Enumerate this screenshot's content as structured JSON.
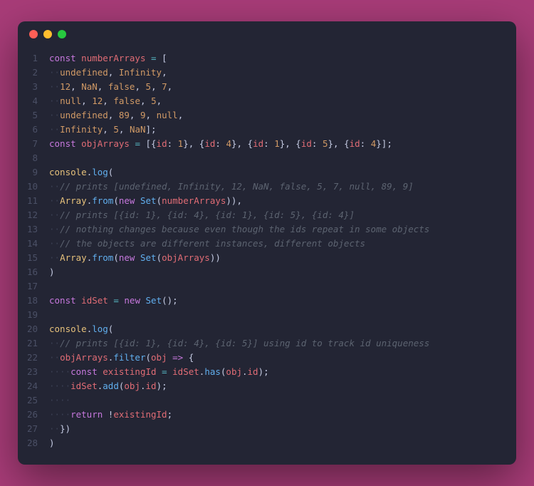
{
  "titlebar": {
    "buttons": [
      "close",
      "minimize",
      "zoom"
    ]
  },
  "code": {
    "lines": [
      [
        {
          "t": "const",
          "c": "kw"
        },
        {
          "t": " "
        },
        {
          "t": "numberArrays",
          "c": "var"
        },
        {
          "t": " "
        },
        {
          "t": "=",
          "c": "op"
        },
        {
          "t": " ["
        }
      ],
      [
        {
          "t": "··",
          "c": "ws"
        },
        {
          "t": "undefined",
          "c": "lit"
        },
        {
          "t": ", "
        },
        {
          "t": "Infinity",
          "c": "lit"
        },
        {
          "t": ","
        }
      ],
      [
        {
          "t": "··",
          "c": "ws"
        },
        {
          "t": "12",
          "c": "lit"
        },
        {
          "t": ", "
        },
        {
          "t": "NaN",
          "c": "lit"
        },
        {
          "t": ", "
        },
        {
          "t": "false",
          "c": "lit"
        },
        {
          "t": ", "
        },
        {
          "t": "5",
          "c": "lit"
        },
        {
          "t": ", "
        },
        {
          "t": "7",
          "c": "lit"
        },
        {
          "t": ","
        }
      ],
      [
        {
          "t": "··",
          "c": "ws"
        },
        {
          "t": "null",
          "c": "lit"
        },
        {
          "t": ", "
        },
        {
          "t": "12",
          "c": "lit"
        },
        {
          "t": ", "
        },
        {
          "t": "false",
          "c": "lit"
        },
        {
          "t": ", "
        },
        {
          "t": "5",
          "c": "lit"
        },
        {
          "t": ","
        }
      ],
      [
        {
          "t": "··",
          "c": "ws"
        },
        {
          "t": "undefined",
          "c": "lit"
        },
        {
          "t": ", "
        },
        {
          "t": "89",
          "c": "lit"
        },
        {
          "t": ", "
        },
        {
          "t": "9",
          "c": "lit"
        },
        {
          "t": ", "
        },
        {
          "t": "null",
          "c": "lit"
        },
        {
          "t": ","
        }
      ],
      [
        {
          "t": "··",
          "c": "ws"
        },
        {
          "t": "Infinity",
          "c": "lit"
        },
        {
          "t": ", "
        },
        {
          "t": "5",
          "c": "lit"
        },
        {
          "t": ", "
        },
        {
          "t": "NaN",
          "c": "lit"
        },
        {
          "t": "];"
        }
      ],
      [
        {
          "t": "const",
          "c": "kw"
        },
        {
          "t": " "
        },
        {
          "t": "objArrays",
          "c": "var"
        },
        {
          "t": " "
        },
        {
          "t": "=",
          "c": "op"
        },
        {
          "t": " [{"
        },
        {
          "t": "id",
          "c": "prop"
        },
        {
          "t": ": "
        },
        {
          "t": "1",
          "c": "lit"
        },
        {
          "t": "}, {"
        },
        {
          "t": "id",
          "c": "prop"
        },
        {
          "t": ": "
        },
        {
          "t": "4",
          "c": "lit"
        },
        {
          "t": "}, {"
        },
        {
          "t": "id",
          "c": "prop"
        },
        {
          "t": ": "
        },
        {
          "t": "1",
          "c": "lit"
        },
        {
          "t": "}, {"
        },
        {
          "t": "id",
          "c": "prop"
        },
        {
          "t": ": "
        },
        {
          "t": "5",
          "c": "lit"
        },
        {
          "t": "}, {"
        },
        {
          "t": "id",
          "c": "prop"
        },
        {
          "t": ": "
        },
        {
          "t": "4",
          "c": "lit"
        },
        {
          "t": "}];"
        }
      ],
      [],
      [
        {
          "t": "console",
          "c": "cls"
        },
        {
          "t": "."
        },
        {
          "t": "log",
          "c": "fn"
        },
        {
          "t": "("
        }
      ],
      [
        {
          "t": "··",
          "c": "ws"
        },
        {
          "t": "// prints [undefined, Infinity, 12, NaN, false, 5, 7, null, 89, 9]",
          "c": "com"
        }
      ],
      [
        {
          "t": "··",
          "c": "ws"
        },
        {
          "t": "Array",
          "c": "cls"
        },
        {
          "t": "."
        },
        {
          "t": "from",
          "c": "fn"
        },
        {
          "t": "("
        },
        {
          "t": "new",
          "c": "kw"
        },
        {
          "t": " "
        },
        {
          "t": "Set",
          "c": "fn"
        },
        {
          "t": "("
        },
        {
          "t": "numberArrays",
          "c": "var"
        },
        {
          "t": ")),"
        }
      ],
      [
        {
          "t": "··",
          "c": "ws"
        },
        {
          "t": "// prints [{id: 1}, {id: 4}, {id: 1}, {id: 5}, {id: 4}]",
          "c": "com"
        }
      ],
      [
        {
          "t": "··",
          "c": "ws"
        },
        {
          "t": "// nothing changes because even though the ids repeat in some objects",
          "c": "com"
        }
      ],
      [
        {
          "t": "··",
          "c": "ws"
        },
        {
          "t": "// the objects are different instances, different objects",
          "c": "com"
        }
      ],
      [
        {
          "t": "··",
          "c": "ws"
        },
        {
          "t": "Array",
          "c": "cls"
        },
        {
          "t": "."
        },
        {
          "t": "from",
          "c": "fn"
        },
        {
          "t": "("
        },
        {
          "t": "new",
          "c": "kw"
        },
        {
          "t": " "
        },
        {
          "t": "Set",
          "c": "fn"
        },
        {
          "t": "("
        },
        {
          "t": "objArrays",
          "c": "var"
        },
        {
          "t": "))"
        }
      ],
      [
        {
          "t": ")"
        }
      ],
      [],
      [
        {
          "t": "const",
          "c": "kw"
        },
        {
          "t": " "
        },
        {
          "t": "idSet",
          "c": "var"
        },
        {
          "t": " "
        },
        {
          "t": "=",
          "c": "op"
        },
        {
          "t": " "
        },
        {
          "t": "new",
          "c": "kw"
        },
        {
          "t": " "
        },
        {
          "t": "Set",
          "c": "fn"
        },
        {
          "t": "();"
        }
      ],
      [],
      [
        {
          "t": "console",
          "c": "cls"
        },
        {
          "t": "."
        },
        {
          "t": "log",
          "c": "fn"
        },
        {
          "t": "("
        }
      ],
      [
        {
          "t": "··",
          "c": "ws"
        },
        {
          "t": "// prints [{id: 1}, {id: 4}, {id: 5}] using id to track id uniqueness",
          "c": "com"
        }
      ],
      [
        {
          "t": "··",
          "c": "ws"
        },
        {
          "t": "objArrays",
          "c": "var"
        },
        {
          "t": "."
        },
        {
          "t": "filter",
          "c": "fn"
        },
        {
          "t": "("
        },
        {
          "t": "obj",
          "c": "var"
        },
        {
          "t": " "
        },
        {
          "t": "=>",
          "c": "arrow"
        },
        {
          "t": " {"
        }
      ],
      [
        {
          "t": "····",
          "c": "ws"
        },
        {
          "t": "const",
          "c": "kw"
        },
        {
          "t": " "
        },
        {
          "t": "existingId",
          "c": "var"
        },
        {
          "t": " "
        },
        {
          "t": "=",
          "c": "op"
        },
        {
          "t": " "
        },
        {
          "t": "idSet",
          "c": "var"
        },
        {
          "t": "."
        },
        {
          "t": "has",
          "c": "fn"
        },
        {
          "t": "("
        },
        {
          "t": "obj",
          "c": "var"
        },
        {
          "t": "."
        },
        {
          "t": "id",
          "c": "prop"
        },
        {
          "t": ");"
        }
      ],
      [
        {
          "t": "····",
          "c": "ws"
        },
        {
          "t": "idSet",
          "c": "var"
        },
        {
          "t": "."
        },
        {
          "t": "add",
          "c": "fn"
        },
        {
          "t": "("
        },
        {
          "t": "obj",
          "c": "var"
        },
        {
          "t": "."
        },
        {
          "t": "id",
          "c": "prop"
        },
        {
          "t": ");"
        }
      ],
      [
        {
          "t": "····",
          "c": "ws"
        }
      ],
      [
        {
          "t": "····",
          "c": "ws"
        },
        {
          "t": "return",
          "c": "kw"
        },
        {
          "t": " !"
        },
        {
          "t": "existingId",
          "c": "var"
        },
        {
          "t": ";"
        }
      ],
      [
        {
          "t": "··",
          "c": "ws"
        },
        {
          "t": "})"
        }
      ],
      [
        {
          "t": ")"
        }
      ]
    ]
  }
}
